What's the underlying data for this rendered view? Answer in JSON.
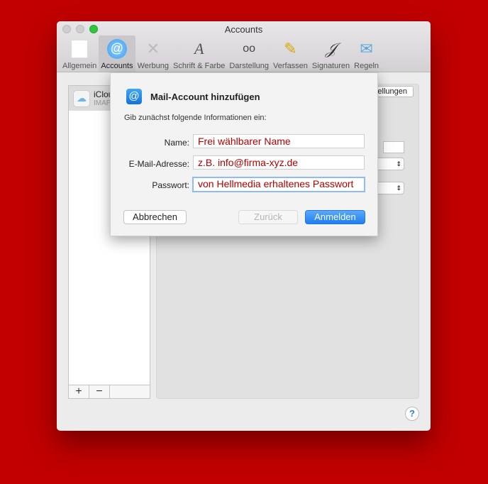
{
  "window": {
    "title": "Accounts"
  },
  "toolbar": {
    "items": [
      {
        "label": "Allgemein",
        "icon": "switch-icon"
      },
      {
        "label": "Accounts",
        "icon": "at-icon",
        "active": true
      },
      {
        "label": "Werbung",
        "icon": "junk-bin-icon"
      },
      {
        "label": "Schrift & Farbe",
        "icon": "font-color-icon"
      },
      {
        "label": "Darstellung",
        "icon": "glasses-icon"
      },
      {
        "label": "Verfassen",
        "icon": "pencil-icon"
      },
      {
        "label": "Signaturen",
        "icon": "signature-icon"
      },
      {
        "label": "Regeln",
        "icon": "rules-icon"
      }
    ]
  },
  "sidebar": {
    "account": {
      "name": "iClou",
      "type": "IMAP"
    },
    "add": "+",
    "remove": "−"
  },
  "panel": {
    "settings_button": "ellungen"
  },
  "dialog": {
    "title": "Mail-Account hinzufügen",
    "subtitle": "Gib zunächst folgende Informationen ein:",
    "fields": [
      {
        "label": "Name:",
        "value": "Frei wählbarer Name"
      },
      {
        "label": "E-Mail-Adresse:",
        "value": "z.B. info@firma-xyz.de"
      },
      {
        "label": "Passwort:",
        "value": "von Hellmedia erhaltenes Passwort"
      }
    ],
    "cancel": "Abbrechen",
    "back": "Zurück",
    "signin": "Anmelden"
  },
  "help": "?",
  "colors": {
    "background": "#c20000",
    "accent": "#2a86f0",
    "field_text": "#b30000"
  }
}
